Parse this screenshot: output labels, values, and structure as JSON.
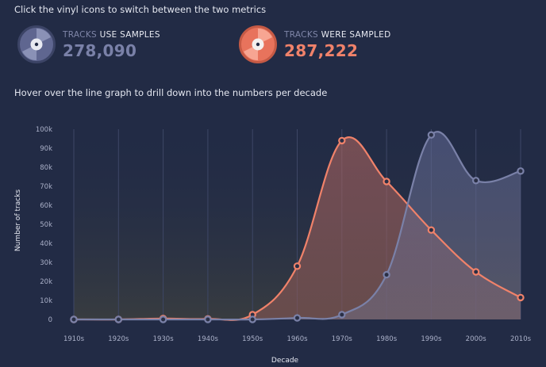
{
  "instructions": {
    "switch_metrics": "Click the vinyl icons to switch between the two metrics",
    "hover_hint": "Hover over the line graph to drill down into the numbers per decade"
  },
  "metrics": {
    "uses_samples": {
      "label_dim": "TRACKS",
      "label_bright": "USE SAMPLES",
      "value": "278,090",
      "color": "#7a81a8",
      "icon": "vinyl-record-icon"
    },
    "were_sampled": {
      "label_dim": "TRACKS",
      "label_bright": "WERE SAMPLED",
      "value": "287,222",
      "color": "#f0826a",
      "icon": "vinyl-record-icon"
    }
  },
  "chart_data": {
    "type": "area",
    "xlabel": "Decade",
    "ylabel": "Number of tracks",
    "categories": [
      "1910s",
      "1920s",
      "1930s",
      "1940s",
      "1950s",
      "1960s",
      "1970s",
      "1980s",
      "1990s",
      "2000s",
      "2010s"
    ],
    "ylim": [
      0,
      100000
    ],
    "y_ticks": [
      "0",
      "10k",
      "20k",
      "30k",
      "40k",
      "50k",
      "60k",
      "70k",
      "80k",
      "90k",
      "100k"
    ],
    "grid": "vertical",
    "series": [
      {
        "color": "#f0826a",
        "values": [
          0,
          0,
          500,
          300,
          2500,
          28000,
          94000,
          72500,
          47000,
          25000,
          11500
        ]
      },
      {
        "color": "#7a81a8",
        "values": [
          0,
          0,
          0,
          0,
          0,
          800,
          2500,
          23500,
          97000,
          73000,
          78000
        ]
      }
    ]
  }
}
